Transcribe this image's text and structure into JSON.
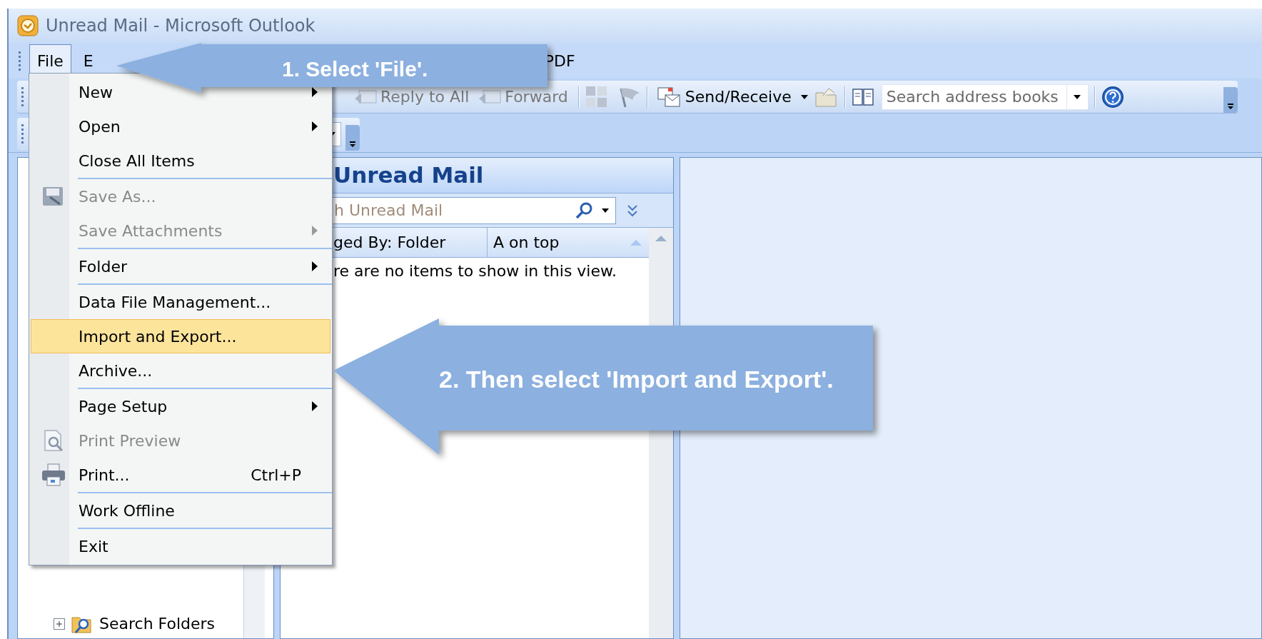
{
  "window": {
    "title": "Unread Mail - Microsoft Outlook"
  },
  "menu_bar": [
    {
      "label": "File",
      "selected": true
    },
    {
      "label": "E",
      "selected": false
    },
    {
      "label": "PDF",
      "selected": false
    }
  ],
  "toolbar": {
    "buttons": [
      {
        "label": "Reply to All",
        "disabled": true
      },
      {
        "label": "Forward",
        "disabled": true
      },
      {
        "label": "Send/Receive",
        "disabled": false
      }
    ],
    "search": {
      "placeholder": "Search address books"
    }
  },
  "file_menu": [
    {
      "label": "New",
      "submenu": true,
      "disabled": false,
      "selected": false,
      "separator_before": false
    },
    {
      "label": "Open",
      "submenu": true,
      "disabled": false,
      "selected": false,
      "separator_before": false
    },
    {
      "label": "Close All Items",
      "submenu": false,
      "disabled": false,
      "selected": false,
      "separator_before": false
    },
    {
      "label": "Save As...",
      "submenu": false,
      "disabled": true,
      "selected": false,
      "separator_before": true
    },
    {
      "label": "Save Attachments",
      "submenu": true,
      "disabled": true,
      "selected": false,
      "separator_before": false
    },
    {
      "label": "Folder",
      "submenu": true,
      "disabled": false,
      "selected": false,
      "separator_before": true
    },
    {
      "label": "Data File Management...",
      "submenu": false,
      "disabled": false,
      "selected": false,
      "separator_before": true
    },
    {
      "label": "Import and Export...",
      "submenu": false,
      "disabled": false,
      "selected": true,
      "separator_before": false
    },
    {
      "label": "Archive...",
      "submenu": false,
      "disabled": false,
      "selected": false,
      "separator_before": false
    },
    {
      "label": "Page Setup",
      "submenu": true,
      "disabled": false,
      "selected": false,
      "separator_before": true
    },
    {
      "label": "Print Preview",
      "submenu": false,
      "disabled": true,
      "selected": false,
      "separator_before": false
    },
    {
      "label": "Print...",
      "shortcut": "Ctrl+P",
      "submenu": false,
      "disabled": false,
      "selected": false,
      "separator_before": false
    },
    {
      "label": "Work Offline",
      "submenu": false,
      "disabled": false,
      "selected": false,
      "separator_before": true
    },
    {
      "label": "Exit",
      "submenu": false,
      "disabled": false,
      "selected": false,
      "separator_before": true
    }
  ],
  "navigation_pane": {
    "folders": [
      {
        "label": "Search Folders",
        "expanded": false
      }
    ]
  },
  "mail_list": {
    "title": "Unread Mail",
    "search": {
      "placeholder": "h Unread Mail"
    },
    "arranged_by": "ged By: Folder",
    "sort": "A on top",
    "empty_text": "re are no items to show in this view."
  },
  "callouts": [
    {
      "text": "1. Select 'File'."
    },
    {
      "text": "2. Then select 'Import and Export'."
    }
  ]
}
